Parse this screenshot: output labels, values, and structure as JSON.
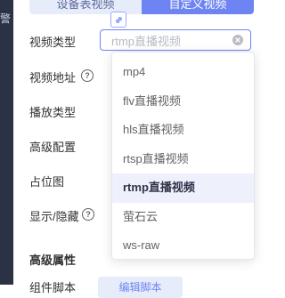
{
  "tabs": {
    "items": [
      "设备表视频",
      "自定义视频"
    ],
    "active_index": 1
  },
  "background_fragment": "警",
  "form": {
    "fields": [
      {
        "label": "视频类型",
        "help": false
      },
      {
        "label": "视频地址",
        "help": true
      },
      {
        "label": "播放类型",
        "help": false
      },
      {
        "label": "高级配置",
        "help": false
      },
      {
        "label": "占位图",
        "help": false
      },
      {
        "label": "显示/隐藏",
        "help": true
      }
    ],
    "select_placeholder": "rtmp直播视频",
    "section_title": "高级属性",
    "component_script_label": "组件脚本",
    "edit_script_button": "编辑脚本"
  },
  "dropdown": {
    "options": [
      "mp4",
      "flv直播视频",
      "hls直播视频",
      "rtsp直播视频",
      "rtmp直播视频",
      "萤石云",
      "ws-raw"
    ],
    "selected_index": 4
  },
  "colors": {
    "accent": "#6e84f2",
    "tab_inactive_bg": "#e7ecfb",
    "sidebar_bg": "#2b3245"
  },
  "icons": {
    "link": "link-icon",
    "help": "question-circle-icon",
    "clear": "clear-circle-icon"
  }
}
